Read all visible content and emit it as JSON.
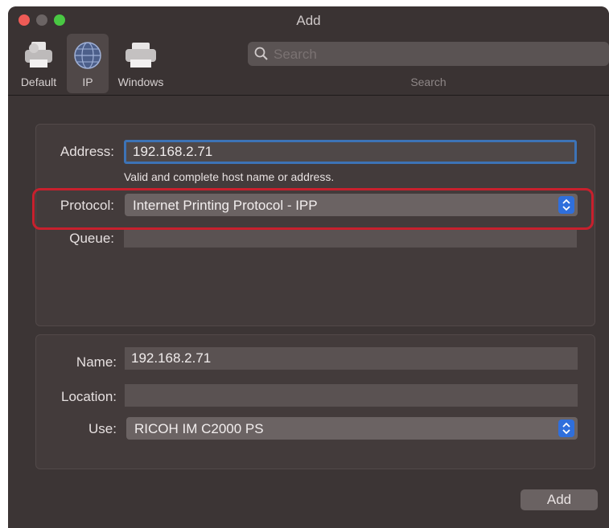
{
  "window": {
    "title": "Add"
  },
  "toolbar": {
    "items": [
      {
        "label": "Default",
        "icon": "printer-icon"
      },
      {
        "label": "IP",
        "icon": "globe-icon"
      },
      {
        "label": "Windows",
        "icon": "printer-icon"
      }
    ],
    "search": {
      "placeholder": "Search",
      "label": "Search"
    }
  },
  "connection": {
    "address": {
      "label": "Address:",
      "value": "192.168.2.71",
      "hint": "Valid and complete host name or address."
    },
    "protocol": {
      "label": "Protocol:",
      "selected": "Internet Printing Protocol - IPP"
    },
    "queue": {
      "label": "Queue:",
      "value": ""
    }
  },
  "printer": {
    "name": {
      "label": "Name:",
      "value": "192.168.2.71"
    },
    "location": {
      "label": "Location:",
      "value": ""
    },
    "use": {
      "label": "Use:",
      "selected": "RICOH IM C2000 PS"
    }
  },
  "actions": {
    "add_label": "Add"
  },
  "colors": {
    "highlight": "#c8202d",
    "accent": "#2f6fdc",
    "focus_ring": "#3d73b6"
  }
}
